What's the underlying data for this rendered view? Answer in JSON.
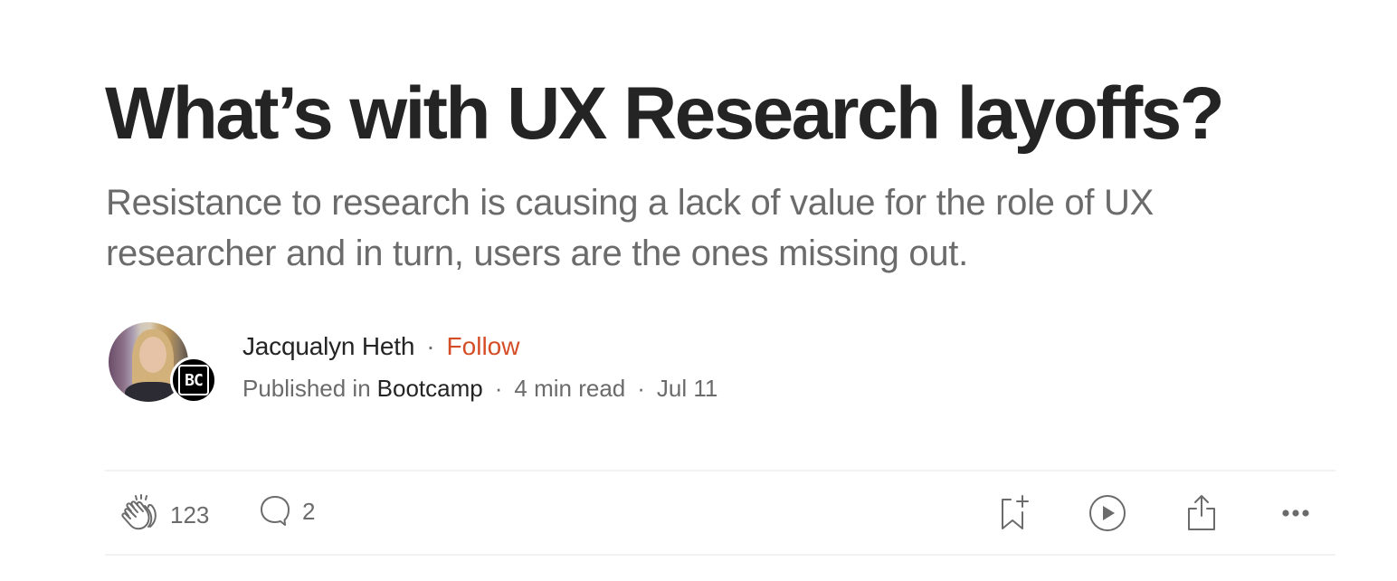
{
  "article": {
    "title": "What’s with UX Research layoffs?",
    "subtitle": "Resistance to research is causing a lack of value for the role of UX researcher and in turn, users are the ones missing out."
  },
  "byline": {
    "author_name": "Jacqualyn Heth",
    "separator": "·",
    "follow_label": "Follow",
    "published_in_label": "Published in",
    "publication_name": "Bootcamp",
    "publication_badge_text": "BC",
    "read_time": "4 min read",
    "date": "Jul 11"
  },
  "actions": {
    "claps": {
      "icon": "clap-icon",
      "count": "123"
    },
    "responses": {
      "icon": "comment-icon",
      "count": "2"
    },
    "save": {
      "icon": "bookmark-add-icon"
    },
    "listen": {
      "icon": "play-icon"
    },
    "share": {
      "icon": "share-icon"
    },
    "more": {
      "icon": "more-icon"
    }
  },
  "colors": {
    "text_primary": "#242424",
    "text_secondary": "#6b6b6b",
    "accent_follow": "#d54d27",
    "divider": "#f2f2f2"
  }
}
